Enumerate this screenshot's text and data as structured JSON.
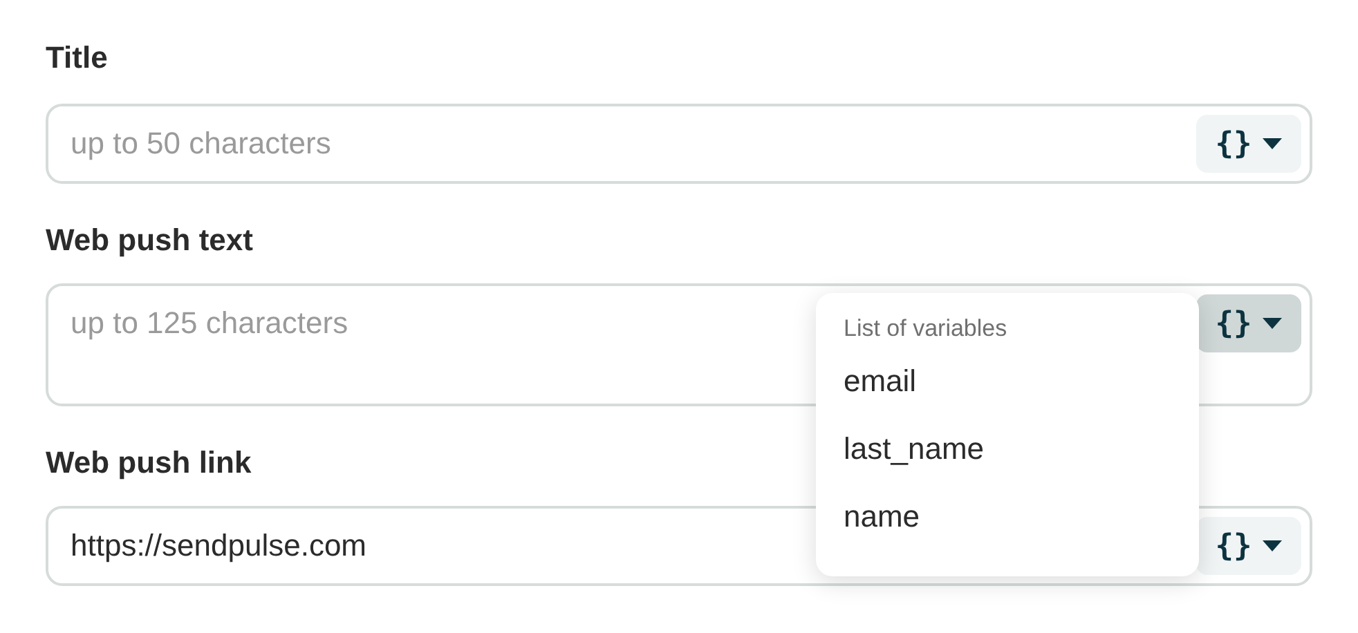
{
  "fields": [
    {
      "label": "Title",
      "kind": "single",
      "placeholder": "up to 50 characters",
      "variables_button": {
        "symbol": "{}",
        "open": false
      }
    },
    {
      "label": "Web push text",
      "kind": "multi",
      "placeholder": "up to 125 characters",
      "variables_button": {
        "symbol": "{}",
        "open": true
      },
      "menu": {
        "header": "List of variables",
        "items": [
          "email",
          "last_name",
          "name"
        ]
      }
    },
    {
      "label": "Web push link",
      "kind": "single",
      "value": "https://sendpulse.com",
      "variables_button": {
        "symbol": "{}",
        "open": false
      }
    }
  ]
}
